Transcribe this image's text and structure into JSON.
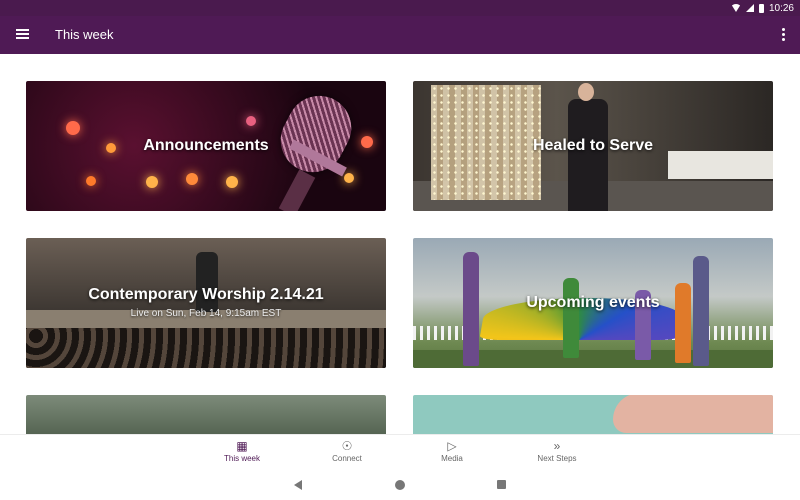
{
  "status_bar": {
    "time": "10:26",
    "icons": [
      "wifi-icon",
      "signal-icon",
      "battery-icon"
    ]
  },
  "app_bar": {
    "title": "This week",
    "menu_icon": "menu-icon",
    "more_icon": "more-vert-icon",
    "background_color": "#4f1a55"
  },
  "cards": [
    {
      "title": "Announcements",
      "subtitle": ""
    },
    {
      "title": "Healed to Serve",
      "subtitle": ""
    },
    {
      "title": "Contemporary Worship 2.14.21",
      "subtitle": "Live on Sun, Feb 14, 9:15am EST"
    },
    {
      "title": "Upcoming events",
      "subtitle": ""
    },
    {
      "title": "",
      "subtitle": ""
    },
    {
      "title": "",
      "subtitle": ""
    }
  ],
  "bottom_nav": {
    "items": [
      {
        "label": "This week",
        "icon": "calendar-icon",
        "active": true
      },
      {
        "label": "Connect",
        "icon": "people-icon",
        "active": false
      },
      {
        "label": "Media",
        "icon": "media-play-icon",
        "active": false
      },
      {
        "label": "Next Steps",
        "icon": "double-chevron-icon",
        "active": false
      }
    ]
  },
  "system_nav": {
    "buttons": [
      "back-icon",
      "home-icon",
      "recents-icon"
    ]
  }
}
